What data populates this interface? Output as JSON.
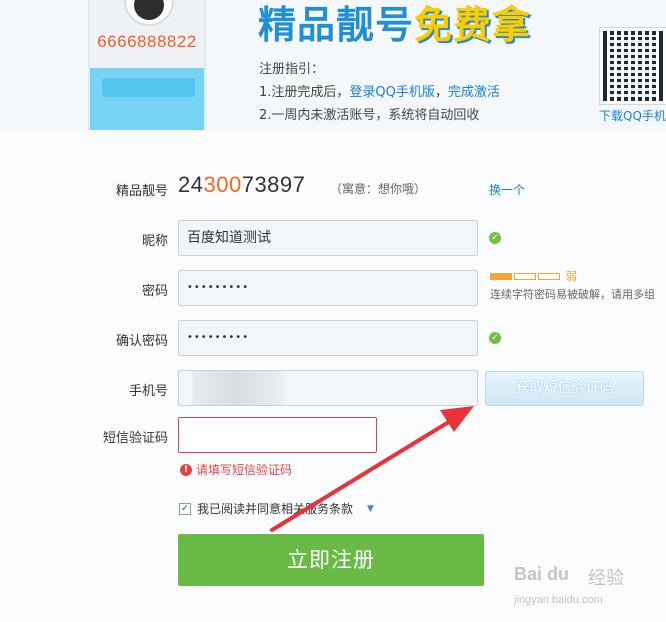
{
  "banner": {
    "phone_number": "6666888822",
    "slogan_blue": "精品靓号",
    "slogan_yellow": "免费拿",
    "guide_title": "注册指引：",
    "guide_line1_prefix": "1.注册完成后，",
    "guide_line1_link1": "登录QQ手机版",
    "guide_line1_sep": "，",
    "guide_line1_link2": "完成激活",
    "guide_line2": "2.一周内未激活账号，系统将自动回收",
    "qr_caption": "下载QQ手机"
  },
  "form": {
    "lucky_label": "精品靓号",
    "lucky_number_part1": "24",
    "lucky_number_part2": "300",
    "lucky_number_part3": "73897",
    "lucky_meaning": "（寓意：想你哦）",
    "swap_label": "换一个",
    "nickname_label": "昵称",
    "nickname_value": "百度知道测试",
    "password_label": "密码",
    "password_value": "•••••••••",
    "strength_label": "弱",
    "password_hint": "连续字符密码易被破解，请用多组",
    "confirm_label": "确认密码",
    "confirm_value": "•••••••••",
    "phone_label": "手机号",
    "phone_value": "",
    "sms_button": "获取短信验证码",
    "sms_code_label": "短信验证码",
    "sms_code_value": "",
    "sms_error": "请填写短信验证码",
    "agree_text": "我已阅读并同意相关服务条款",
    "submit_label": "立即注册"
  },
  "status": {
    "password_strength_filled": 1,
    "password_strength_total": 3,
    "agree_checked": true
  },
  "colors": {
    "accent_blue": "#1a7fd0",
    "error_red": "#e0434a",
    "submit_green": "#6abb45",
    "lucky_orange": "#f26a1a",
    "annotation_arrow": "#e8333a"
  },
  "icons": {
    "check": "check-circle-icon",
    "error": "error-circle-icon",
    "caret": "caret-down-icon"
  },
  "watermark": {
    "brand": "Bai du",
    "cn": "经验",
    "url": "jingyan.baidu.com"
  }
}
